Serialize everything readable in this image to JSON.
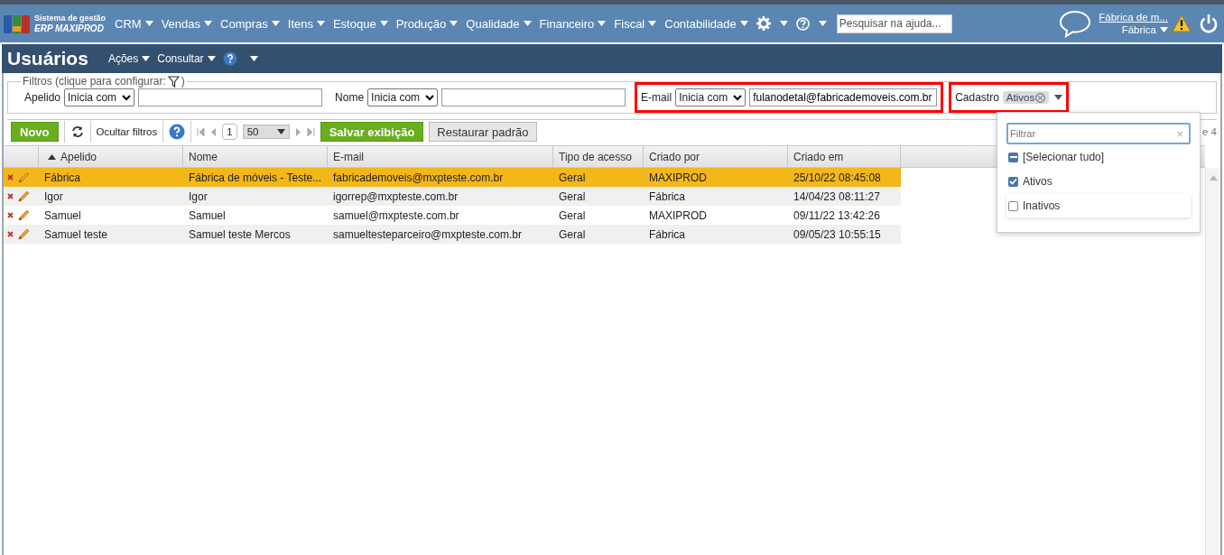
{
  "brand": {
    "line1": "Sistema de gestão",
    "line2": "ERP MAXIPROD"
  },
  "menu": [
    {
      "label": "CRM"
    },
    {
      "label": "Vendas"
    },
    {
      "label": "Compras"
    },
    {
      "label": "Itens"
    },
    {
      "label": "Estoque"
    },
    {
      "label": "Produção"
    },
    {
      "label": "Qualidade"
    },
    {
      "label": "Financeiro"
    },
    {
      "label": "Fiscal"
    },
    {
      "label": "Contabilidade"
    }
  ],
  "help_search": {
    "placeholder": "Pesquisar na ajuda..."
  },
  "user": {
    "company": "Fábrica de m...",
    "branch": "Fábrica"
  },
  "page": {
    "title": "Usuários",
    "actions": [
      {
        "label": "Ações"
      },
      {
        "label": "Consultar"
      }
    ]
  },
  "filters": {
    "legend": "Filtros (clique para configurar:",
    "legend_end": ")",
    "fields": [
      {
        "kind": "text",
        "label": "Apelido",
        "operator": "Inicia com",
        "highlighted": false
      },
      {
        "kind": "text",
        "label": "Nome",
        "operator": "Inicia com",
        "highlighted": false
      },
      {
        "kind": "text",
        "label": "E-mail",
        "operator": "Inicia com",
        "value": "fulanodetal@fabricademoveis.com.br",
        "highlighted": true
      },
      {
        "kind": "tags",
        "label": "Cadastro",
        "tags": [
          "Ativos"
        ],
        "highlighted": true
      }
    ]
  },
  "toolbar": {
    "new": "Novo",
    "hide_filters": "Ocultar filtros",
    "page": "1",
    "page_size": "50",
    "save_view": "Salvar exibição",
    "restore": "Restaurar padrão",
    "pager_info": "e 4"
  },
  "table": {
    "columns": [
      {
        "label": "Apelido",
        "sorted": true
      },
      {
        "label": "Nome",
        "sorted": false
      },
      {
        "label": "E-mail",
        "sorted": false
      },
      {
        "label": "Tipo de acesso",
        "sorted": false
      },
      {
        "label": "Criado por",
        "sorted": false
      },
      {
        "label": "Criado em",
        "sorted": false
      }
    ],
    "rows": [
      {
        "selected": true,
        "cells": [
          "Fábrica",
          "Fábrica de móveis - Teste...",
          "fabricademoveis@mxpteste.com.br",
          "Geral",
          "MAXIPROD",
          "25/10/22 08:45:08"
        ]
      },
      {
        "selected": false,
        "cells": [
          "Igor",
          "Igor",
          "igorrep@mxpteste.com.br",
          "Geral",
          "Fábrica",
          "14/04/23 08:11:27"
        ]
      },
      {
        "selected": false,
        "cells": [
          "Samuel",
          "Samuel",
          "samuel@mxpteste.com.br",
          "Geral",
          "MAXIPROD",
          "09/11/22 13:42:26"
        ]
      },
      {
        "selected": false,
        "cells": [
          "Samuel teste",
          "Samuel teste Mercos",
          "samueltesteparceiro@mxpteste.com.br",
          "Geral",
          "Fábrica",
          "09/05/23 10:55:15"
        ]
      }
    ]
  },
  "dropdown": {
    "placeholder": "Filtrar",
    "clear": "×",
    "options": [
      {
        "kind": "select_all",
        "label": "[Selecionar tudo]",
        "partial": true
      },
      {
        "kind": "option",
        "label": "Ativos",
        "checked": true
      },
      {
        "kind": "option",
        "label": "Inativos",
        "checked": false
      }
    ]
  }
}
